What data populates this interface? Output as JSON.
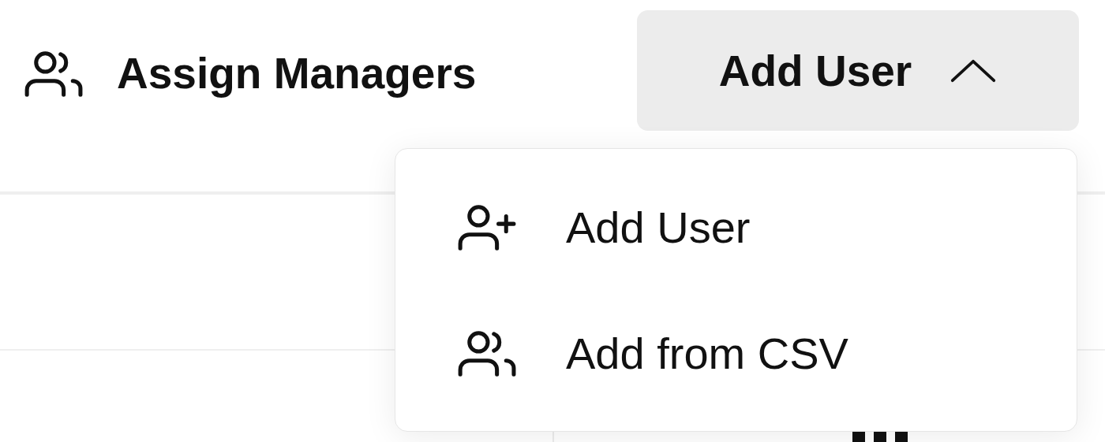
{
  "toolbar": {
    "buttons": [
      {
        "label": "Assign Managers",
        "kind": "assign"
      },
      {
        "label": "Add User",
        "kind": "dropdown",
        "expanded": true
      }
    ]
  },
  "menu": {
    "items": [
      {
        "label": "Add User",
        "kind": "single"
      },
      {
        "label": "Add from CSV",
        "kind": "bulk"
      }
    ]
  }
}
